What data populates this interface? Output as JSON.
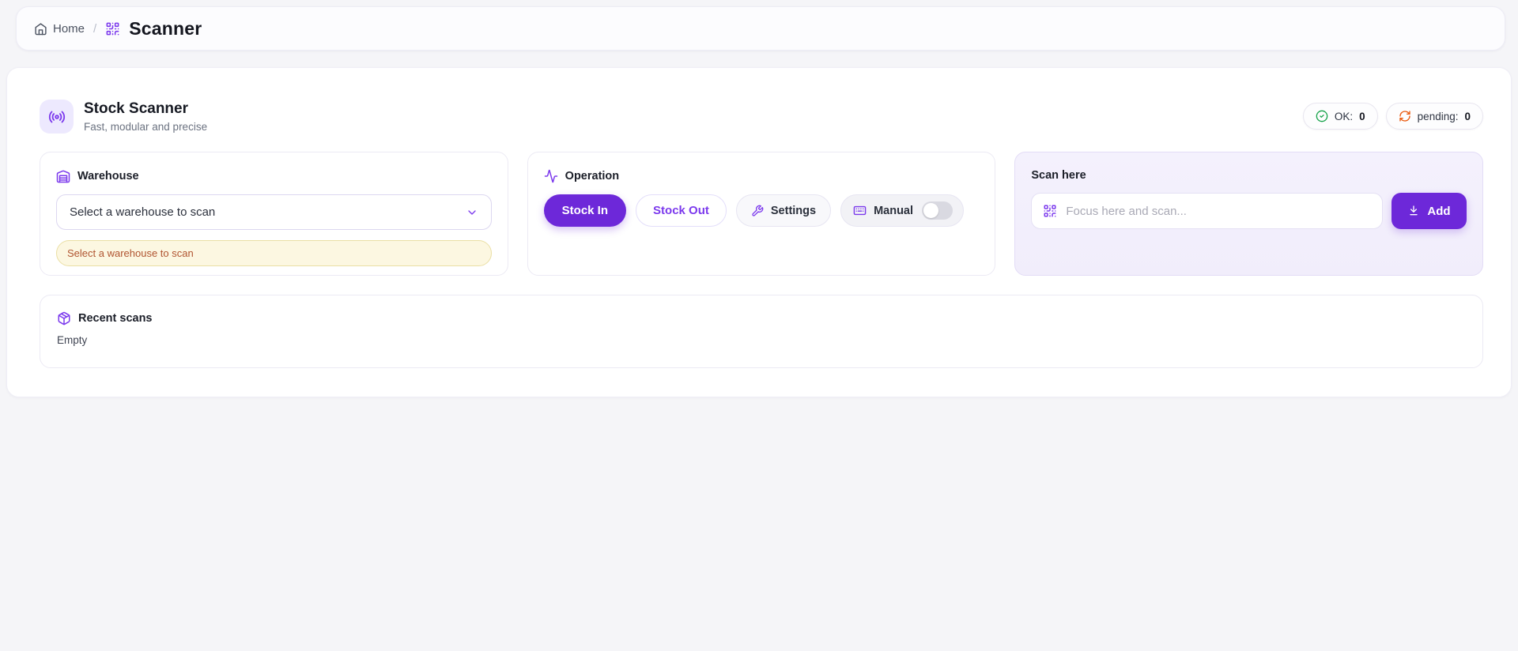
{
  "colors": {
    "accent": "#6d28d9",
    "accent_light": "#7c3aed",
    "accent_tile_bg": "#ede9fe",
    "ok_green": "#16a34a",
    "pending_orange": "#ea580c",
    "warning_bg": "#fcf7e1",
    "warning_text": "#b05430",
    "page_bg": "#f5f5f8"
  },
  "breadcrumb": {
    "home_label": "Home",
    "separator": "/",
    "page_title": "Scanner"
  },
  "header": {
    "title": "Stock Scanner",
    "subtitle": "Fast, modular and precise",
    "badges": {
      "ok_label": "OK:",
      "ok_count": "0",
      "pending_label": "pending:",
      "pending_count": "0"
    }
  },
  "warehouse_card": {
    "label": "Warehouse",
    "select_value": "Select a warehouse to scan",
    "warning": "Select a warehouse to scan"
  },
  "operation_card": {
    "label": "Operation",
    "stock_in_label": "Stock In",
    "stock_out_label": "Stock Out",
    "settings_label": "Settings",
    "manual_label": "Manual",
    "manual_toggle_state": "off",
    "active_mode": "Stock In"
  },
  "scan_card": {
    "label": "Scan here",
    "input_value": "",
    "input_placeholder": "Focus here and scan...",
    "add_label": "Add"
  },
  "recent_card": {
    "label": "Recent scans",
    "empty_text": "Empty"
  },
  "icons": {
    "home": "house outline",
    "scanner": "qr-code",
    "app": "radio-broadcast",
    "ok": "check-circle",
    "pending": "refresh-arrows",
    "warehouse": "warehouse-building",
    "operation": "activity-pulse",
    "settings": "wrench",
    "manual": "keyboard",
    "scan_input": "qr-code",
    "add": "download-arrow",
    "recent": "package-box",
    "select_chevron": "chevron-down"
  }
}
